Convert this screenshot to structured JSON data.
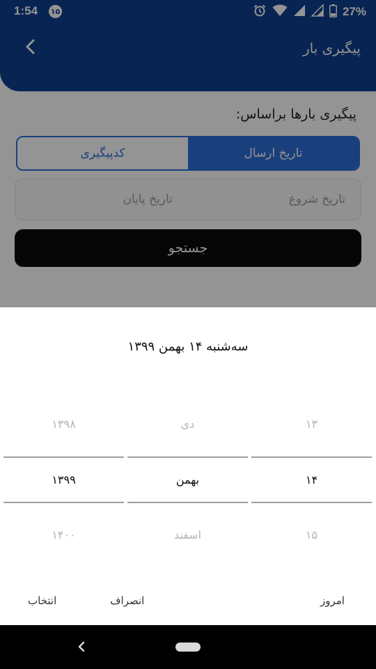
{
  "status_bar": {
    "time": "1:54",
    "notification_badge": "۱۵",
    "battery": "27%"
  },
  "app_bar": {
    "title": "پیگیری بار",
    "back_icon": "chevron-left-icon"
  },
  "content": {
    "section_title": "پیگیری بارها براساس:",
    "tabs": [
      {
        "label": "تاریخ ارسال",
        "active": true
      },
      {
        "label": "کدپیگیری",
        "active": false
      }
    ],
    "date_range": {
      "start_placeholder": "تاریخ شروع",
      "end_placeholder": "تاریخ پایان"
    },
    "search_label": "جستجو"
  },
  "date_picker": {
    "selected_date_text": "سه‌شنبه ۱۴ بهمن ۱۳۹۹",
    "year": {
      "prev": "۱۳۹۸",
      "selected": "۱۳۹۹",
      "next": "۱۴۰۰"
    },
    "month": {
      "prev": "دی",
      "selected": "بهمن",
      "next": "اسفند"
    },
    "day": {
      "prev": "۱۳",
      "selected": "۱۴",
      "next": "۱۵"
    },
    "actions": {
      "select": "انتخاب",
      "cancel": "انصراف",
      "today": "امروز"
    }
  },
  "colors": {
    "primary": "#0f3f8f",
    "accent": "#2b6fd6",
    "button": "#0c0c0c"
  }
}
